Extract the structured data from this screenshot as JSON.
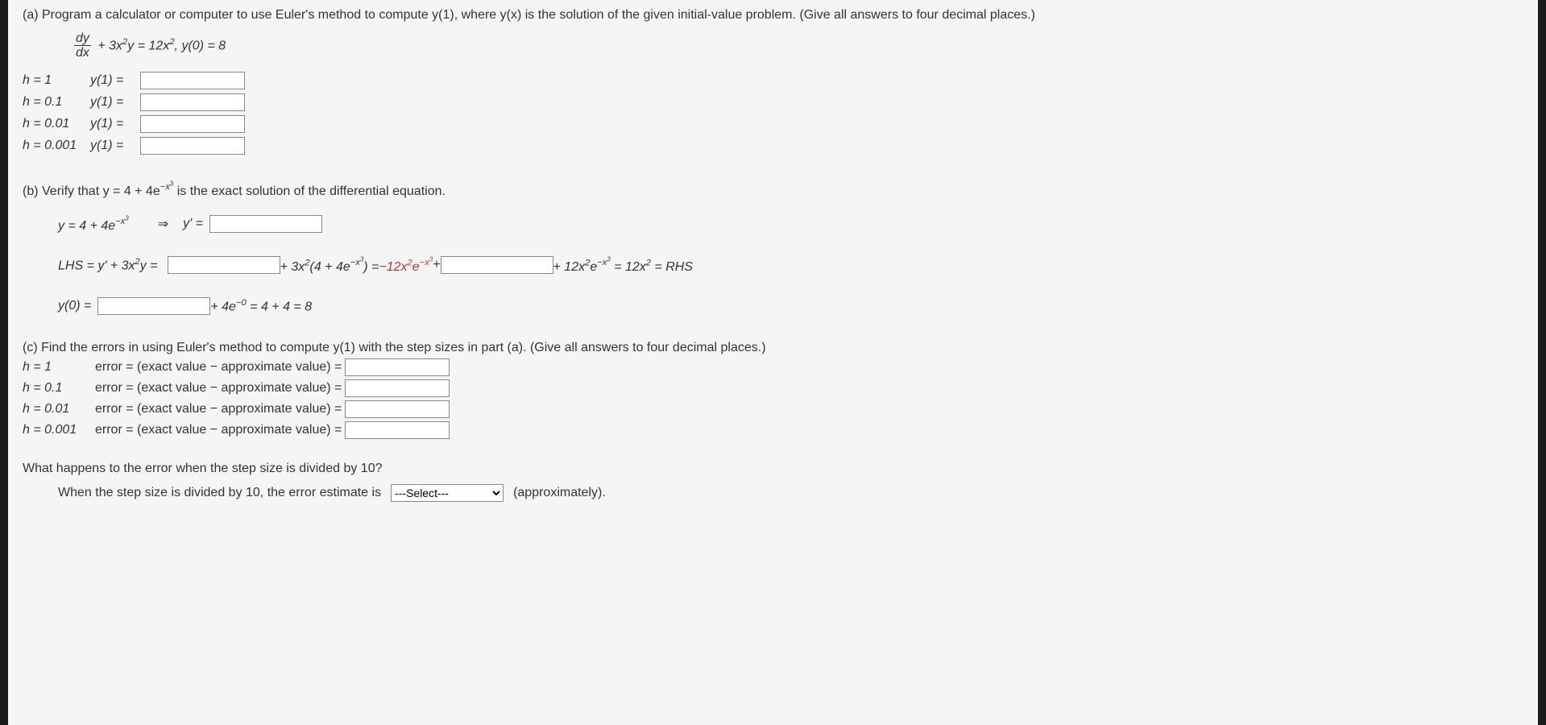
{
  "part_a": {
    "prompt": "(a) Program a calculator or computer to use Euler's method to compute y(1), where y(x) is the solution of the given initial-value problem. (Give all answers to four decimal places.)",
    "equation_frac_num": "dy",
    "equation_frac_den": "dx",
    "equation_plus": " + 3x",
    "equation_y_eq": "y = 12x",
    "equation_cond": ",   y(0) = 8",
    "rows": [
      {
        "h": "h = 1",
        "y": "y(1) ="
      },
      {
        "h": "h = 0.1",
        "y": "y(1) ="
      },
      {
        "h": "h = 0.01",
        "y": "y(1) ="
      },
      {
        "h": "h = 0.001",
        "y": "y(1) ="
      }
    ]
  },
  "part_b": {
    "prompt_pre": "(b) Verify that  y = 4 + 4e",
    "prompt_post": "  is the exact solution of the differential equation.",
    "line1_pre": "y = 4 + 4e",
    "line1_arrow": "⇒",
    "line1_ylabel": "y' =",
    "lhs_label": "LHS = y' + 3x",
    "lhs_label2": "y =",
    "mid1_pre": " + 3x",
    "mid1_mid": "(4 + 4e",
    "mid1_post": ") = ",
    "mid1_red": "−12x",
    "mid1_red2": "e",
    "mid1_plus": " + ",
    "rhs1_pre": " + 12x",
    "rhs1_mid": "e",
    "rhs1_post": " = 12x",
    "rhs_final": " = RHS",
    "line3_y0": "y(0) =",
    "line3_post": " + 4e",
    "line3_final": " = 4 + 4 = 8"
  },
  "part_c": {
    "prompt": "(c) Find the errors in using Euler's method to compute y(1) with the step sizes in part (a). (Give all answers to four decimal places.)",
    "rows": [
      {
        "h": "h = 1",
        "label": "error = (exact value − approximate value) ="
      },
      {
        "h": "h = 0.1",
        "label": "error = (exact value − approximate value) ="
      },
      {
        "h": "h = 0.01",
        "label": "error = (exact value − approximate value) ="
      },
      {
        "h": "h = 0.001",
        "label": "error = (exact value − approximate value) ="
      }
    ],
    "question": "What happens to the error when the step size is divided by 10?",
    "answer_pre": "When the step size is divided by 10, the error estimate is",
    "answer_post": "(approximately).",
    "select_placeholder": "---Select---"
  }
}
